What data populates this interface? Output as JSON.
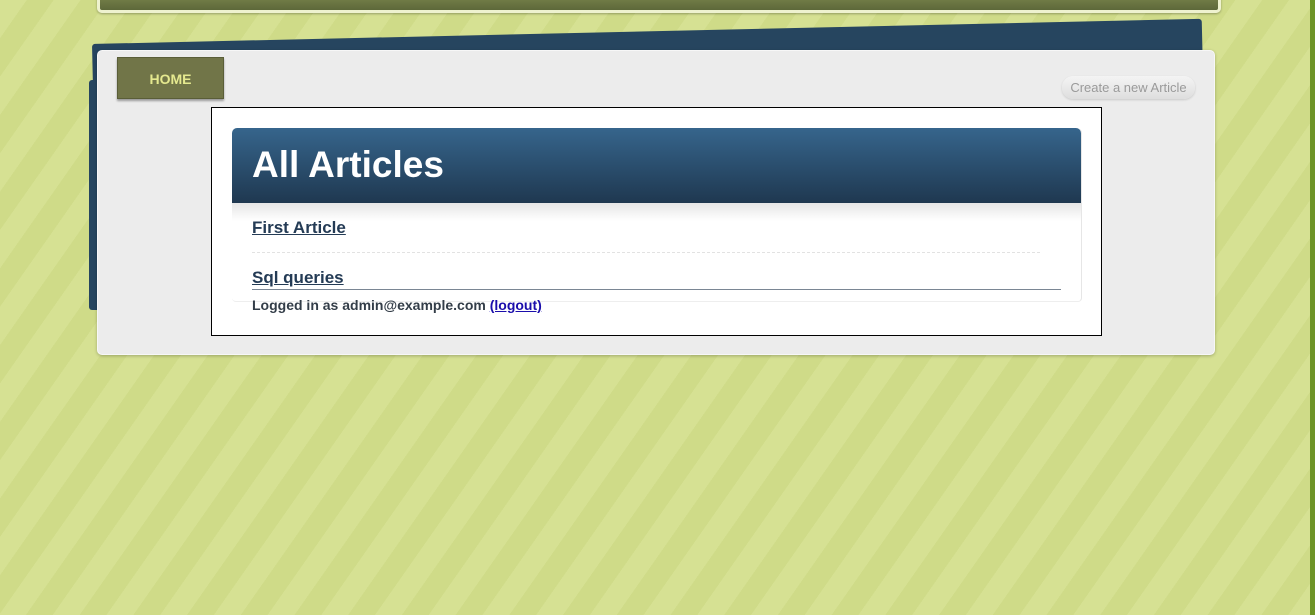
{
  "nav": {
    "home_label": "HOME",
    "create_label": "Create a new Article"
  },
  "main": {
    "title": "All Articles",
    "articles": [
      {
        "title": "First Article"
      },
      {
        "title": "Sql queries"
      }
    ]
  },
  "footer": {
    "logged_in_prefix": "Logged in as",
    "user_email": "admin@example.com",
    "logout_label": "(logout)"
  },
  "colors": {
    "background": "#d3de8e",
    "header_blue": "#2c5274",
    "home_button": "#717548",
    "home_text": "#e5e98f",
    "link": "#243b55",
    "logout_link": "#1a0dab"
  }
}
